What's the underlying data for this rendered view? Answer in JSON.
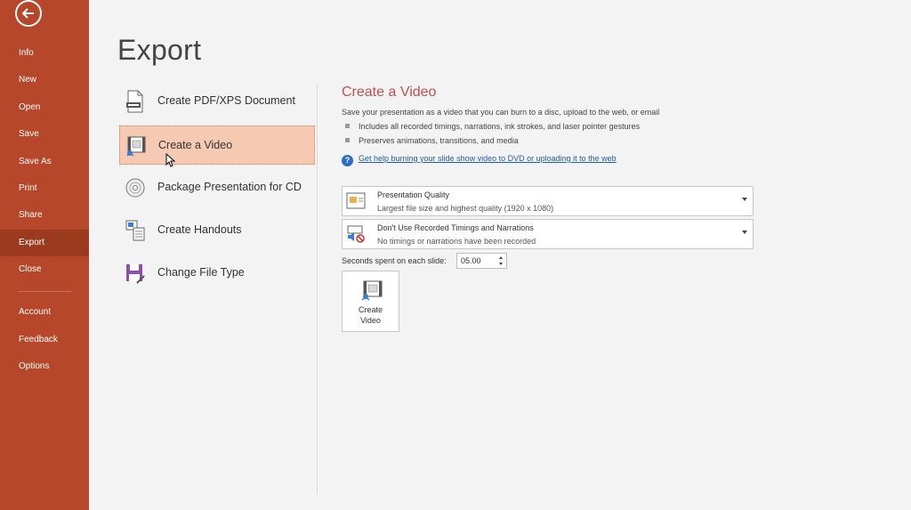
{
  "sidebar": {
    "items": [
      {
        "label": "Info"
      },
      {
        "label": "New"
      },
      {
        "label": "Open"
      },
      {
        "label": "Save"
      },
      {
        "label": "Save As"
      },
      {
        "label": "Print"
      },
      {
        "label": "Share"
      },
      {
        "label": "Export"
      },
      {
        "label": "Close"
      },
      {
        "label": "Account"
      },
      {
        "label": "Feedback"
      },
      {
        "label": "Options"
      }
    ],
    "active": "Export",
    "accent": "#b7472a"
  },
  "page": {
    "title": "Export"
  },
  "export_options": [
    {
      "label": "Create PDF/XPS Document",
      "icon": "pdf-document-icon"
    },
    {
      "label": "Create a Video",
      "icon": "video-icon",
      "selected": true
    },
    {
      "label": "Package Presentation for CD",
      "icon": "cd-icon"
    },
    {
      "label": "Create Handouts",
      "icon": "handouts-icon"
    },
    {
      "label": "Change File Type",
      "icon": "file-type-icon"
    }
  ],
  "details": {
    "title": "Create a Video",
    "description": "Save your presentation as a video that you can burn to a disc, upload to the web, or email",
    "bullets": [
      "Includes all recorded timings, narrations, ink strokes, and laser pointer gestures",
      "Preserves animations, transitions, and media"
    ],
    "help_link": "Get help burning your slide show video to DVD or uploading it to the web",
    "quality_dropdown": {
      "title": "Presentation Quality",
      "subtitle": "Largest file size and highest quality (1920 x 1080)"
    },
    "timings_dropdown": {
      "title": "Don't Use Recorded Timings and Narrations",
      "subtitle": "No timings or narrations have been recorded"
    },
    "seconds_label": "Seconds spent on each slide:",
    "seconds_value": "05.00",
    "create_button": {
      "line1": "Create",
      "line2": "Video"
    }
  }
}
